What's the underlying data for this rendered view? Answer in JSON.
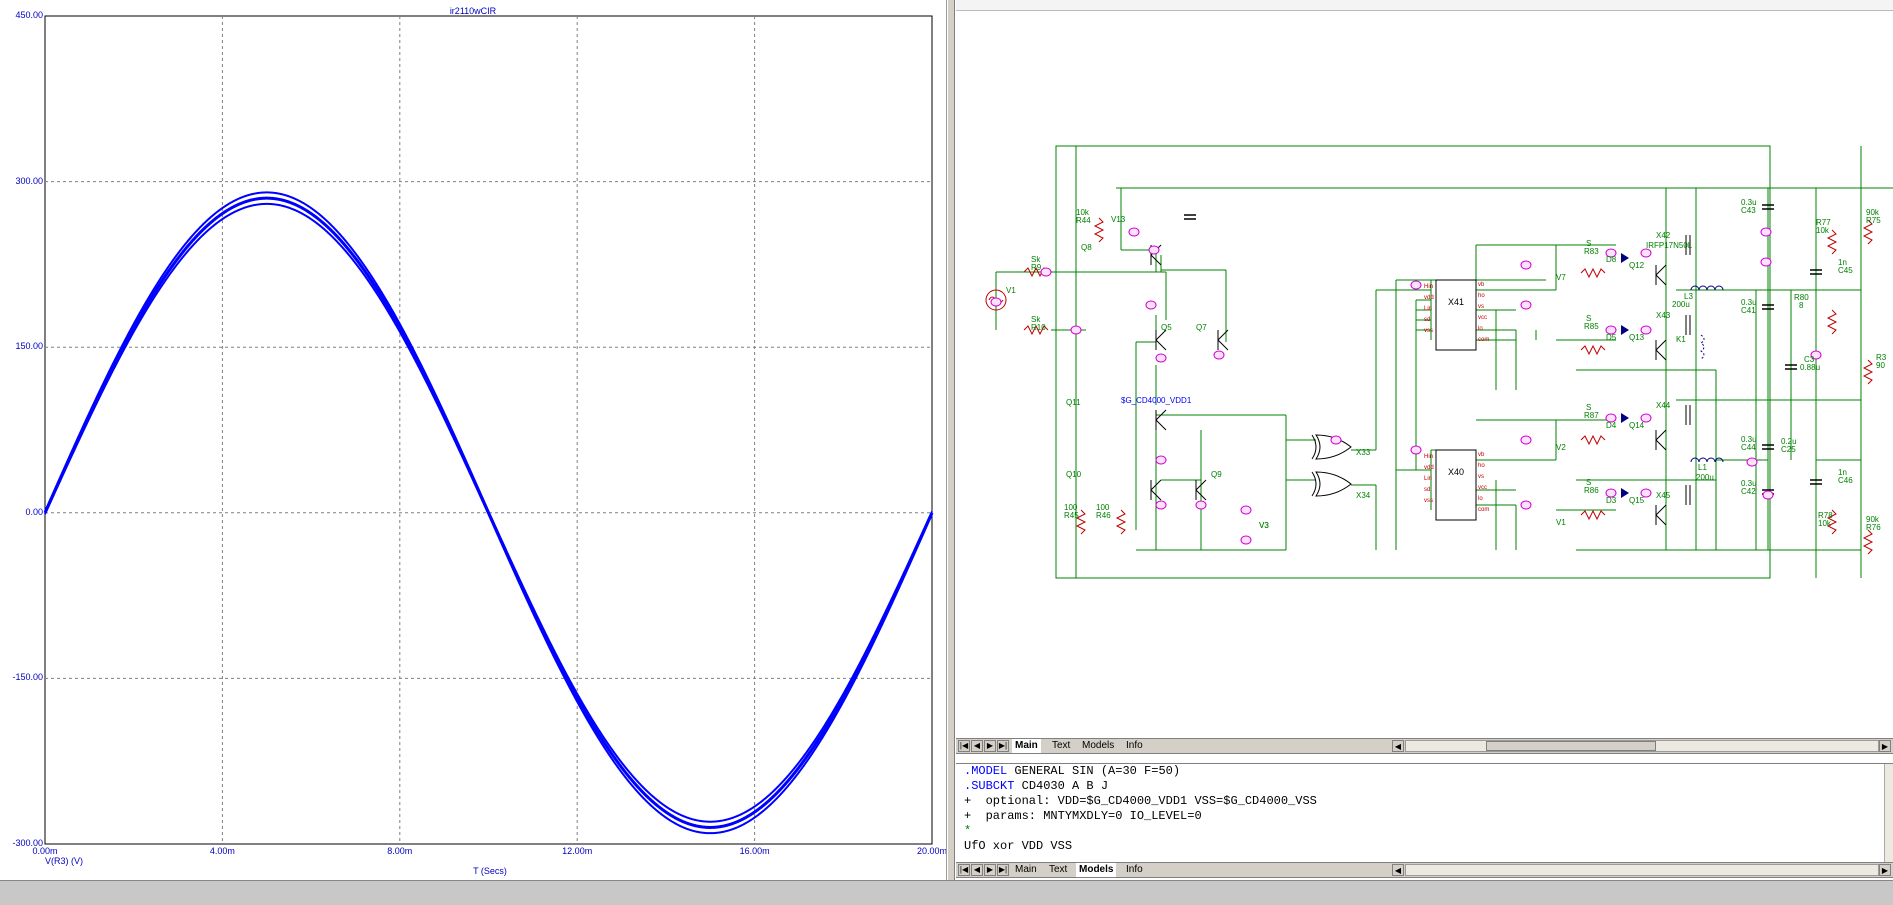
{
  "colors": {
    "curve": "#0000ff",
    "axis_text": "#0000c0",
    "wire": "#008000",
    "component": "#c00000",
    "node": "#cc00cc",
    "label": "#008000",
    "net_label": "#0000ff"
  },
  "plot": {
    "title": "ir2110wCIR",
    "x_axis_label": "T (Secs)",
    "y_axis_label": "V(R3) (V)",
    "y_ticks": [
      "450.00",
      "300.00",
      "150.00",
      "0.00",
      "-150.00",
      "-300.00"
    ],
    "x_ticks": [
      "0.00m",
      "4.00m",
      "8.00m",
      "12.00m",
      "16.00m",
      "20.00m"
    ]
  },
  "chart_data": {
    "type": "line",
    "title": "ir2110wCIR",
    "xlabel": "T (Secs)",
    "ylabel": "V(R3) (V)",
    "xlim": [
      0,
      0.02
    ],
    "ylim": [
      -300,
      450
    ],
    "grid": true,
    "series": [
      {
        "name": "V(R3) (V)",
        "function": "sine",
        "amplitude_v": 285,
        "frequency_hz": 50,
        "x": [
          0,
          0.0025,
          0.005,
          0.0075,
          0.01,
          0.0125,
          0.015,
          0.0175,
          0.02
        ],
        "values": [
          0,
          201,
          285,
          201,
          0,
          -201,
          -285,
          -201,
          0
        ]
      }
    ]
  },
  "schematic": {
    "labels": [
      "Sk",
      "R9",
      "V1",
      "Sk",
      "R10",
      "10k",
      "R44",
      "V13",
      "Q8",
      "Q5",
      "Q7",
      "Q11",
      "$G_CD4000_VDD1",
      "Q10",
      "Q9",
      "100",
      "R45",
      "100",
      "R46",
      "X33",
      "X34",
      "V3",
      "X41",
      "X40",
      "V7",
      "V2",
      "V1",
      "V3",
      "S",
      "R83",
      "D8",
      "Q12",
      "X42",
      "IRFP17N50L",
      "S",
      "R85",
      "D5",
      "Q13",
      "X43",
      "S",
      "R87",
      "D4",
      "Q14",
      "X44",
      "S",
      "R86",
      "D3",
      "Q15",
      "X45",
      "200u",
      "L3",
      "K1",
      "200u",
      "L1",
      "0.3u",
      "C43",
      "0.3u",
      "C41",
      "0.3u",
      "C44",
      "0.3u",
      "C42",
      "0.2u",
      "C25",
      "C3",
      "0.88u",
      "R77",
      "10k",
      "90k",
      "R75",
      "1n",
      "C45",
      "R80",
      "8",
      "R3",
      "90",
      "1n",
      "C46",
      "R78",
      "10k",
      "90k",
      "R76",
      "V3"
    ],
    "ic_pins": [
      "Hin",
      "vdd",
      "Lin",
      "sd",
      "vss",
      "vb",
      "ho",
      "vs",
      "vcc",
      "lo",
      "com"
    ]
  },
  "tabs_main": {
    "active": "Main",
    "items": [
      "Main",
      "Text",
      "Models",
      "Info"
    ]
  },
  "tabs_text": {
    "active": "Models",
    "items": [
      "Main",
      "Text",
      "Models",
      "Info"
    ]
  },
  "text_area": {
    "lines": [
      {
        "kw": ".MODEL",
        "rest": " GENERAL SIN (A=30 F=50)"
      },
      {
        "kw": ".SUBCKT",
        "rest": " CD4030 A B J"
      },
      {
        "kw": "",
        "rest": "+  optional: VDD=$G_CD4000_VDD1 VSS=$G_CD4000_VSS"
      },
      {
        "kw": "",
        "rest": "+  params: MNTYMXDLY=0 IO_LEVEL=0"
      },
      {
        "kw": "",
        "rest": "*"
      },
      {
        "kw": "",
        "rest": "UfO xor VDD VSS"
      }
    ]
  }
}
